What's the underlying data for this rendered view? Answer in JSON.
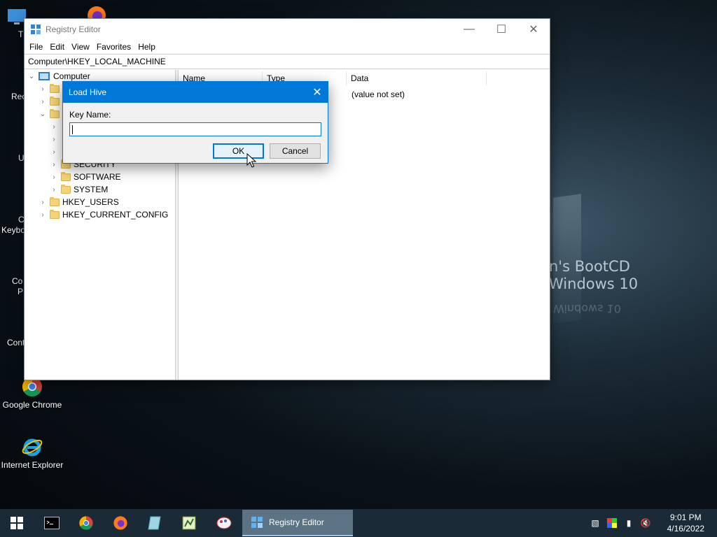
{
  "desktop": {
    "background_text_1": "n's BootCD",
    "background_text_2": "Windows 10",
    "background_text_3": "Windows 10",
    "icons": [
      {
        "label": "Google Chrome"
      },
      {
        "label": "Internet Explorer"
      }
    ],
    "edge_labels": [
      "Th",
      "Rec",
      "U",
      "C",
      "Keybo",
      "Co",
      "P",
      "Cont"
    ]
  },
  "window": {
    "title": "Registry Editor",
    "menu": [
      "File",
      "Edit",
      "View",
      "Favorites",
      "Help"
    ],
    "address": "Computer\\HKEY_LOCAL_MACHINE",
    "tree": {
      "root": "Computer",
      "hklm_children": [
        "SECURITY",
        "SOFTWARE",
        "SYSTEM"
      ],
      "hives": [
        "HKEY_USERS",
        "HKEY_CURRENT_CONFIG"
      ]
    },
    "columns": [
      "Name",
      "Type",
      "Data"
    ],
    "rows": [
      {
        "data": "(value not set)"
      }
    ]
  },
  "dialog": {
    "title": "Load Hive",
    "label": "Key Name:",
    "value": "",
    "ok": "OK",
    "cancel": "Cancel"
  },
  "taskbar": {
    "active_app": "Registry Editor",
    "time": "9:01 PM",
    "date": "4/16/2022"
  },
  "colors": {
    "accent": "#0078d7",
    "taskbar": "#1a2a37"
  }
}
